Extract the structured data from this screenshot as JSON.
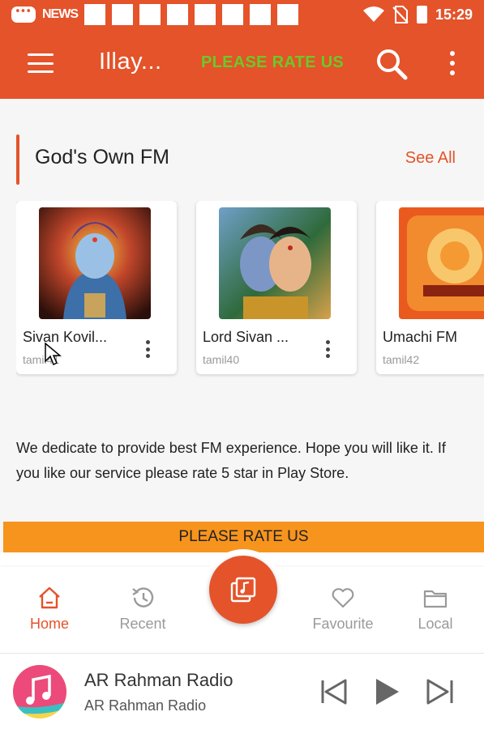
{
  "status_bar": {
    "news_label": "NEWS",
    "time": "15:29"
  },
  "app_bar": {
    "title": "Illay...",
    "rate_label": "PLEASE RATE US"
  },
  "section": {
    "title": "God's Own FM",
    "see_all": "See All"
  },
  "cards": [
    {
      "name": "Sivan Kovil...",
      "sub": "tamil41",
      "icon": "shiva-image"
    },
    {
      "name": "Lord Sivan ...",
      "sub": "tamil40",
      "icon": "shiva-parvati-image"
    },
    {
      "name": "Umachi FM",
      "sub": "tamil42",
      "icon": "umachi-image"
    }
  ],
  "description": "We dedicate to provide best FM experience. Hope you will like it. If you like our service please rate 5 star in Play Store.",
  "rate_banner": "PLEASE RATE US",
  "bottom_nav": {
    "items": [
      {
        "label": "Home",
        "icon": "home-icon",
        "active": true
      },
      {
        "label": "Recent",
        "icon": "history-icon",
        "active": false
      },
      {
        "label": "Favourite",
        "icon": "heart-icon",
        "active": false
      },
      {
        "label": "Local",
        "icon": "folder-icon",
        "active": false
      }
    ],
    "fab_icon": "music-library-icon"
  },
  "player": {
    "title": "AR Rahman Radio",
    "subtitle": "AR Rahman Radio"
  },
  "colors": {
    "primary": "#e4532a",
    "rate_green": "#6bc928",
    "banner": "#f7941d"
  }
}
